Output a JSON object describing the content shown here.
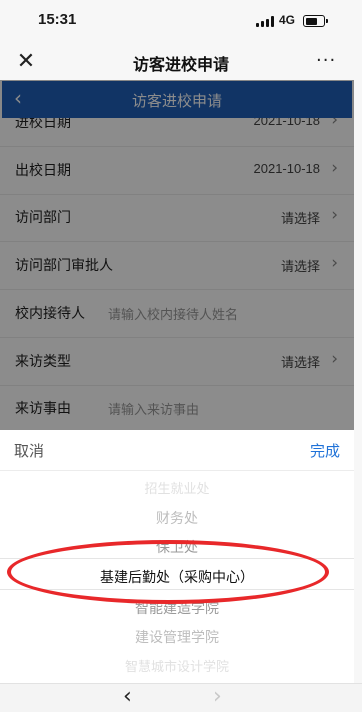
{
  "status_bar": {
    "time": "15:31",
    "network": "4G"
  },
  "app_bar": {
    "title": "访客进校申请",
    "close_glyph": "✕",
    "more_glyph": "···"
  },
  "page_nav": {
    "back_glyph": "‹",
    "title": "访客进校申请"
  },
  "form": {
    "rows": [
      {
        "label": "进校日期",
        "value": "2021-10-18",
        "chevron": "›"
      },
      {
        "label": "出校日期",
        "value": "2021-10-18",
        "chevron": "›"
      },
      {
        "label": "访问部门",
        "value": "请选择",
        "chevron": "›"
      },
      {
        "label": "访问部门审批人",
        "value": "请选择",
        "chevron": "›"
      },
      {
        "label": "校内接待人",
        "placeholder": "请输入校内接待人姓名"
      },
      {
        "label": "来访类型",
        "value": "请选择",
        "chevron": "›"
      },
      {
        "label": "来访事由",
        "placeholder": "请输入来访事由"
      }
    ]
  },
  "picker": {
    "cancel_label": "取消",
    "done_label": "完成",
    "options": [
      "招生就业处",
      "财务处",
      "保卫处",
      "基建后勤处（采购中心）",
      "智能建造学院",
      "建设管理学院",
      "智慧城市设计学院"
    ],
    "selected_index": 3
  },
  "toolbar": {
    "back_glyph": "‹",
    "forward_glyph": "›"
  },
  "colors": {
    "nav_blue": "#1f5fb8",
    "done_blue": "#1f72d8",
    "annotation_red": "#e8282a"
  },
  "icons": {
    "close": "close-icon",
    "more": "more-icon",
    "back": "chevron-left-icon",
    "forward": "chevron-right-icon",
    "signal": "cellular-signal-icon",
    "battery": "battery-icon"
  }
}
